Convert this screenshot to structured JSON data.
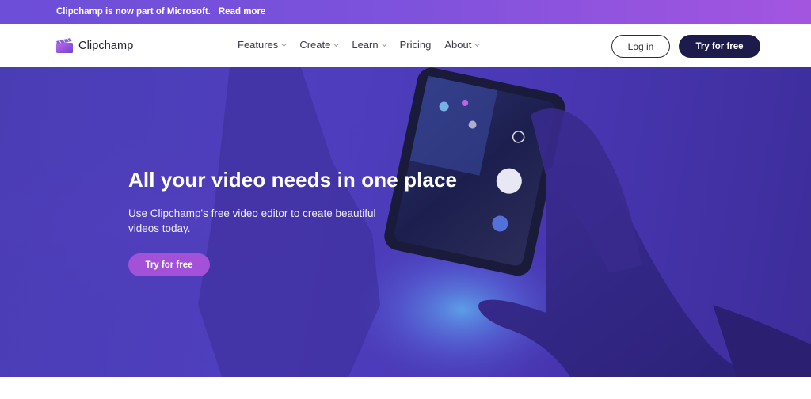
{
  "announcement": {
    "text": "Clipchamp is now part of Microsoft.",
    "link": "Read more"
  },
  "nav": {
    "brand": "Clipchamp",
    "items": [
      {
        "label": "Features",
        "has_dropdown": true
      },
      {
        "label": "Create",
        "has_dropdown": true
      },
      {
        "label": "Learn",
        "has_dropdown": true
      },
      {
        "label": "Pricing",
        "has_dropdown": false
      },
      {
        "label": "About",
        "has_dropdown": true
      }
    ],
    "login_label": "Log in",
    "cta_label": "Try for free"
  },
  "hero": {
    "title": "All your video needs in one place",
    "subtitle": "Use Clipchamp's free video editor to create beautiful videos today.",
    "cta_label": "Try for free"
  },
  "colors": {
    "announcement_bg": "#7e52dc",
    "nav_cta_bg": "#1d1b4b",
    "hero_cta_bg": "#a251d8",
    "hero_bg": "#4b3cb8"
  }
}
